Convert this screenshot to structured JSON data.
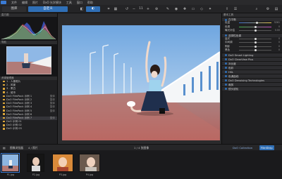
{
  "menu": [
    "文件",
    "编辑",
    "照片",
    "DxO 光学模块",
    "工具",
    "窗口",
    "帮助"
  ],
  "toolbar": {
    "tab_library": "图库",
    "tab_customize": "自定义",
    "zoom": "11"
  },
  "left": {
    "histogram_title": "直方图",
    "navigator_title": "导航",
    "browser_title": "资源管理器",
    "tree": [
      {
        "label": "1 - 人像照片",
        "count": ""
      },
      {
        "label": "2 - 风景",
        "count": ""
      },
      {
        "label": "3 - 黑白",
        "count": ""
      },
      {
        "label": "4 - 城市",
        "count": ""
      },
      {
        "label": "DxO FilmPack 示例 1",
        "count": "整体"
      },
      {
        "label": "DxO FilmPack 示例 2",
        "count": "整体"
      },
      {
        "label": "DxO FilmPack 示例 3",
        "count": "整体"
      },
      {
        "label": "DxO FilmPack 示例 4",
        "count": "整体"
      },
      {
        "label": "DxO FilmPack 示例 5",
        "count": "整体"
      },
      {
        "label": "DxO FilmPack 示例 6",
        "count": ""
      },
      {
        "label": "DxO FilmPack 示例 7",
        "count": "整体"
      },
      {
        "label": "DxO 示例 01",
        "count": ""
      },
      {
        "label": "DxO 示例 02",
        "count": ""
      },
      {
        "label": "DxO 示例 03",
        "count": ""
      }
    ]
  },
  "right": {
    "panel_title": "基本工具",
    "rows": [
      {
        "label": "白平衡",
        "type": "section"
      },
      {
        "label": "色温",
        "value": "5261",
        "type": "slider",
        "pos": 0.55
      },
      {
        "label": "色调",
        "value": "0",
        "type": "slider",
        "pos": 0.5
      },
      {
        "label": "曝光补偿",
        "value": "0.00",
        "type": "slider",
        "pos": 0.5
      },
      {
        "label": "选择性色调",
        "type": "section"
      },
      {
        "label": "高光",
        "value": "0",
        "type": "slider",
        "pos": 0.5
      },
      {
        "label": "中间调",
        "value": "0",
        "type": "slider",
        "pos": 0.5
      },
      {
        "label": "阴影",
        "value": "0",
        "type": "slider",
        "pos": 0.5
      },
      {
        "label": "黑色",
        "value": "0",
        "type": "slider",
        "pos": 0.5
      },
      {
        "label": "DxO Smart Lighting",
        "type": "section"
      },
      {
        "label": "DxO ClearView Plus",
        "type": "section"
      },
      {
        "label": "对比度",
        "type": "section"
      },
      {
        "label": "色彩",
        "type": "section"
      },
      {
        "label": "HSL",
        "type": "section"
      },
      {
        "label": "色调曲线",
        "type": "section"
      },
      {
        "label": "DxO Denoising Technologies",
        "type": "section"
      },
      {
        "label": "裁剪",
        "type": "section"
      },
      {
        "label": "镜头锐化",
        "type": "section"
      }
    ]
  },
  "filmstrip": {
    "bar_left": "图像浏览器",
    "bar_path": "4 / 照片",
    "bar_center": "1 / 4 张图像",
    "bar_right_tab": "FilmStrip",
    "collection_tab": "DxO Collection",
    "thumbs": [
      "P1.jpg",
      "P2.jpg",
      "P3.jpg",
      "P4.jpg"
    ]
  }
}
